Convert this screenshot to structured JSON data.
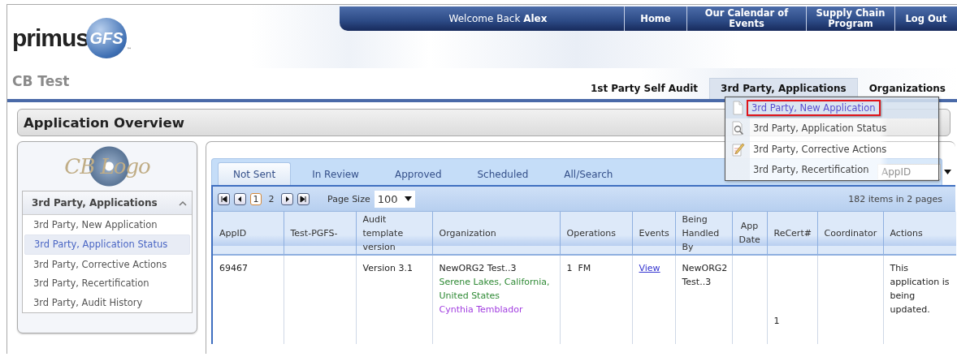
{
  "logo": {
    "word": "primus",
    "badge": "GFS",
    "mark": "™"
  },
  "nav": {
    "welcome": "Welcome Back **Alex**",
    "links": [
      "Home",
      "Our Calendar of Events",
      "Supply Chain Program",
      "Log Out"
    ]
  },
  "page_title": "CB Test",
  "main_tabs": [
    {
      "label": "1st Party Self Audit",
      "selected": false
    },
    {
      "label": "3rd Party, Applications",
      "selected": true
    },
    {
      "label": "Organizations",
      "selected": false
    }
  ],
  "menu": {
    "items": [
      {
        "label": "3rd Party, New Application",
        "kind": "page",
        "highlighted": true
      },
      {
        "label": "3rd Party, Application Status",
        "kind": "magnifier",
        "highlighted": false
      },
      {
        "label": "3rd Party, Corrective Actions",
        "kind": "pencil",
        "highlighted": false
      },
      {
        "label": "3rd Party, Recertification",
        "kind": "none",
        "highlighted": false
      }
    ]
  },
  "section_title": "Application Overview",
  "sidebar": {
    "logo_text": "CB Logo",
    "header": "3rd Party, Applications",
    "expanded": true,
    "items": [
      {
        "label": "3rd Party, New Application",
        "selected": false
      },
      {
        "label": "3rd Party, Application Status",
        "selected": true
      },
      {
        "label": "3rd Party, Corrective Actions",
        "selected": false
      },
      {
        "label": "3rd Party, Recertification",
        "selected": false
      },
      {
        "label": "3rd Party, Audit History",
        "selected": false
      }
    ]
  },
  "grid": {
    "tabs": [
      {
        "label": "Not Sent",
        "selected": true
      },
      {
        "label": "In Review",
        "selected": false
      },
      {
        "label": "Approved",
        "selected": false
      },
      {
        "label": "Scheduled",
        "selected": false
      },
      {
        "label": "All/Search",
        "selected": false
      }
    ],
    "search": {
      "placeholder": "AppID"
    },
    "pager": {
      "pages": [
        {
          "label": "1",
          "selected": true
        },
        {
          "label": "2",
          "selected": false
        }
      ],
      "page_size_label": "Page Size",
      "page_size": "100",
      "summary": "182 items in 2 pages"
    },
    "columns": [
      "AppID",
      "Test-PGFS-",
      "Audit template version",
      "Organization",
      "Operations",
      "Events",
      "Being Handled By",
      "App Date",
      "ReCert#",
      "Coordinator",
      "Actions"
    ],
    "rows": [
      {
        "app_id": "69467",
        "test_pgfs": "",
        "version": "Version 3.1",
        "org_name": "NewORG2 Test..3",
        "org_location": "Serene Lakes, California, United States",
        "org_contact": "Cynthia Temblador",
        "operations": "1  FM",
        "events": "View",
        "handled_by": "NewORG2 Test..3",
        "app_date": "",
        "recert": "1",
        "coordinator": "",
        "actions": "This application is being updated."
      }
    ]
  }
}
